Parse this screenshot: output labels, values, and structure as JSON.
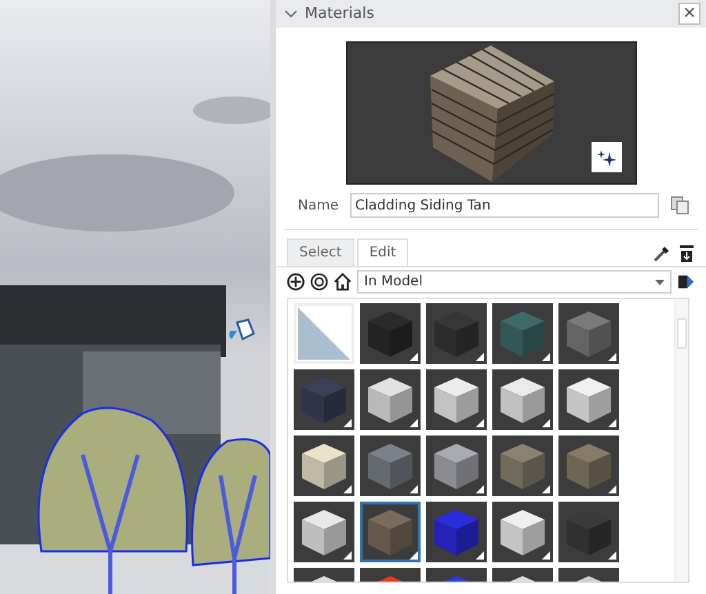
{
  "panel": {
    "title": "Materials",
    "expanded": true
  },
  "name_field": {
    "label": "Name",
    "value": "Cladding Siding Tan"
  },
  "tabs": [
    {
      "label": "Select",
      "selected": true
    },
    {
      "label": "Edit",
      "selected": false
    }
  ],
  "collection": {
    "value": "In Model"
  },
  "materials": [
    {
      "kind": "default",
      "color": "#a9bfcf",
      "selected": false
    },
    {
      "kind": "cube",
      "color": "#2b2b2b",
      "selected": false
    },
    {
      "kind": "cube",
      "color": "#363636",
      "selected": false
    },
    {
      "kind": "cube",
      "color": "#3e6a6a",
      "selected": false
    },
    {
      "kind": "cube",
      "color": "#7a7a7a",
      "selected": false
    },
    {
      "kind": "cube",
      "color": "#3b4058",
      "selected": false
    },
    {
      "kind": "cube",
      "color": "#e2e2e2",
      "selected": false
    },
    {
      "kind": "cube",
      "color": "#ececec",
      "selected": false
    },
    {
      "kind": "cube",
      "color": "#eaeaea",
      "selected": false
    },
    {
      "kind": "cube",
      "color": "#f0f0f0",
      "selected": false
    },
    {
      "kind": "cube",
      "color": "#ebe2c9",
      "selected": false
    },
    {
      "kind": "cube",
      "color": "#7b8089",
      "selected": false
    },
    {
      "kind": "cube",
      "color": "#a9abb1",
      "selected": false
    },
    {
      "kind": "cube",
      "color": "#8b8171",
      "selected": false
    },
    {
      "kind": "cube",
      "color": "#867b66",
      "selected": false
    },
    {
      "kind": "cube",
      "color": "#e8e8e8",
      "selected": false
    },
    {
      "kind": "cube",
      "color": "#7b6b5c",
      "selected": true
    },
    {
      "kind": "cube",
      "color": "#2b2be0",
      "selected": false
    },
    {
      "kind": "cube",
      "color": "#efefef",
      "selected": false
    },
    {
      "kind": "cube",
      "color": "#3a3a3a",
      "selected": false
    },
    {
      "kind": "cube",
      "color": "#dedede",
      "selected": false
    },
    {
      "kind": "cube",
      "color": "#e23c22",
      "selected": false
    },
    {
      "kind": "cube",
      "color": "#2c3ce0",
      "selected": false
    },
    {
      "kind": "cube",
      "color": "#dddddd",
      "selected": false
    },
    {
      "kind": "cube",
      "color": "#cdcdcd",
      "selected": false
    }
  ]
}
